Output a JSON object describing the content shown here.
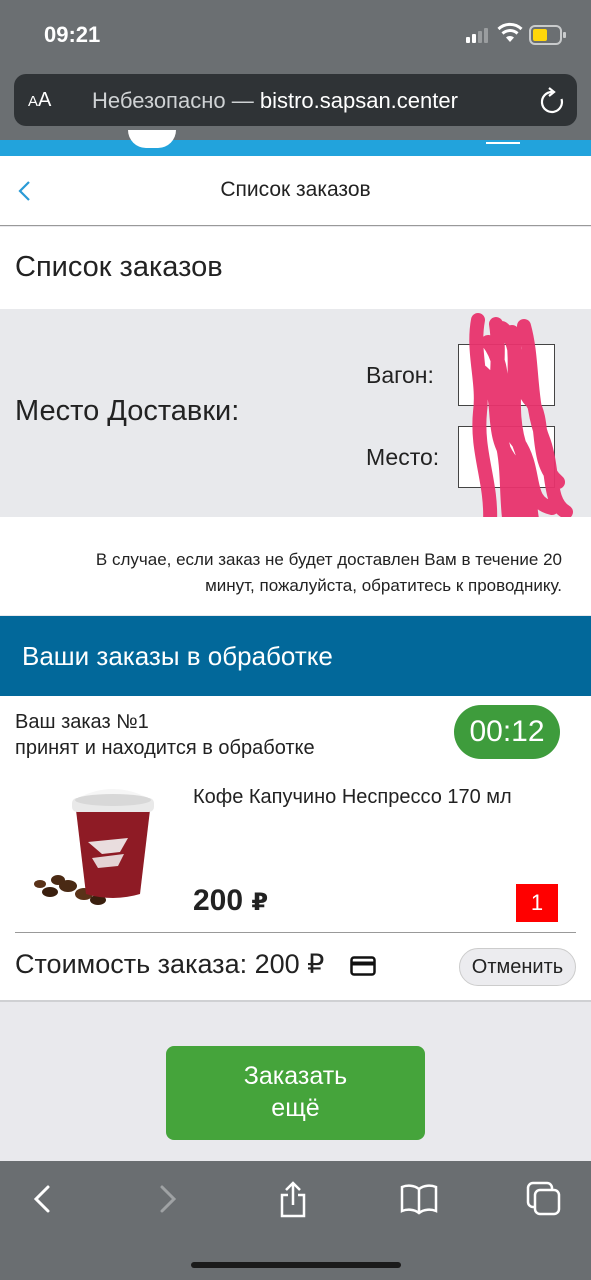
{
  "status_bar": {
    "time": "09:21"
  },
  "browser": {
    "aa_label_small": "A",
    "aa_label_big": "A",
    "security": "Небезопасно —",
    "domain": "bistro.sapsan.center",
    "icons": [
      "reload-icon",
      "back-arrow-icon",
      "forward-arrow-icon",
      "share-icon",
      "bookmarks-icon",
      "tabs-icon"
    ]
  },
  "nav": {
    "title": "Список заказов",
    "back_icon": "chevron-left-icon"
  },
  "page": {
    "title": "Список заказов"
  },
  "delivery": {
    "label": "Место Доставки:",
    "wagon_label": "Вагон:",
    "seat_label": "Место:"
  },
  "notice": {
    "line1": "В случае, если заказ не будет доставлен Вам в течение 20",
    "line2": "минут, пожалуйста, обратитесь к проводнику."
  },
  "processing": {
    "title": "Ваши заказы в обработке"
  },
  "order": {
    "number": "Ваш заказ №1",
    "status": "принят и находится в обработке",
    "timer": "00:12",
    "product": {
      "name": "Кофе Капучино Неспрессо 170 мл",
      "price": "200",
      "currency": "₽",
      "quantity": "1"
    },
    "total_text": "Стоимость заказа: 200 ₽",
    "payment_icon": "credit-card-icon",
    "cancel_label": "Отменить"
  },
  "actions": {
    "order_more_line1": "Заказать",
    "order_more_line2": "ещё"
  },
  "colors": {
    "header_blue": "#02689a",
    "accent_cyan": "#22a3dc",
    "timer_green": "#3e9c3c",
    "button_green": "#45a43b",
    "qty_red": "#ff0000",
    "scribble_pink": "#e8336d"
  }
}
